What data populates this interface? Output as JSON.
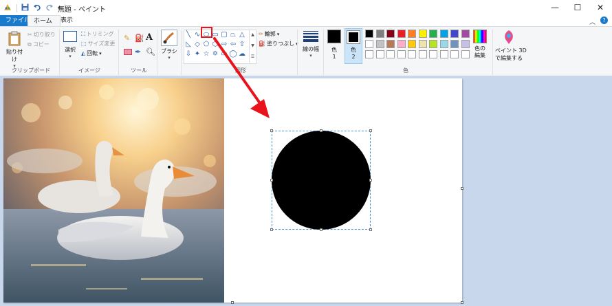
{
  "window": {
    "title": "無題 - ペイント",
    "minimize": "—",
    "maximize": "☐",
    "close": "✕"
  },
  "tabs": {
    "file": "ファイル",
    "home": "ホーム",
    "view": "表示",
    "help": "?"
  },
  "ribbon": {
    "clipboard": {
      "paste": "貼り付け",
      "cut": "切り取り",
      "copy": "コピー",
      "label": "クリップボード"
    },
    "image": {
      "select": "選択",
      "crop": "トリミング",
      "resize": "サイズ変更",
      "rotate": "回転",
      "label": "イメージ"
    },
    "tools": {
      "label": "ツール"
    },
    "brush": {
      "label": "ブラシ"
    },
    "shapes": {
      "outline": "輪郭",
      "fill": "塗りつぶし",
      "label": "図形"
    },
    "size": {
      "label": "線の幅"
    },
    "color1": {
      "label": "色",
      "num": "1"
    },
    "color2": {
      "label": "色",
      "num": "2"
    },
    "colors": {
      "label": "色",
      "edit": "色の\n編集",
      "row1": [
        "#000000",
        "#7f7f7f",
        "#880015",
        "#ed1c24",
        "#ff7f27",
        "#fff200",
        "#22b14c",
        "#00a2e8",
        "#3f48cc",
        "#a349a4"
      ],
      "row2": [
        "#ffffff",
        "#c3c3c3",
        "#b97a57",
        "#ffaec9",
        "#ffc90e",
        "#efe4b0",
        "#b5e61d",
        "#99d9ea",
        "#7092be",
        "#c8bfe7"
      ],
      "row3": [
        "#ffffff",
        "#ffffff",
        "#ffffff",
        "#ffffff",
        "#ffffff",
        "#ffffff",
        "#ffffff",
        "#ffffff",
        "#ffffff",
        "#ffffff"
      ]
    },
    "paint3d": {
      "line1": "ペイント 3D",
      "line2": "で編集する"
    }
  },
  "annotation": {
    "arrow_color": "#e8131b",
    "highlight_color": "#e8131b"
  }
}
